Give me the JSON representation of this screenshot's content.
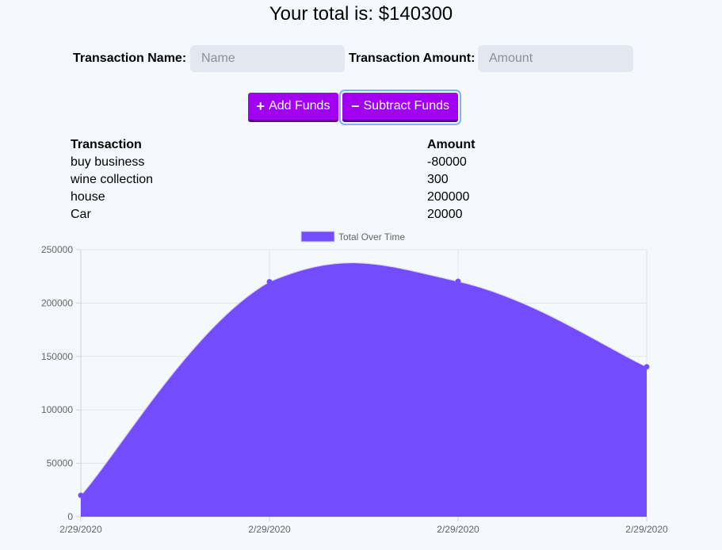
{
  "header": {
    "total_text": "Your total is: $140300"
  },
  "form": {
    "name_label": "Transaction Name:",
    "name_placeholder": "Name",
    "amount_label": "Transaction Amount:",
    "amount_placeholder": "Amount",
    "add_label": "Add Funds",
    "subtract_label": "Subtract Funds"
  },
  "table": {
    "headers": [
      "Transaction",
      "Amount"
    ],
    "rows": [
      [
        "buy business",
        "-80000"
      ],
      [
        "wine collection",
        "300"
      ],
      [
        "house",
        "200000"
      ],
      [
        "Car",
        "20000"
      ]
    ]
  },
  "colors": {
    "accent": "#a100f2",
    "chart_fill": "#744cff",
    "focus_ring": "#7fb0ff"
  },
  "chart_data": {
    "type": "area",
    "x": [
      "2/29/2020",
      "2/29/2020",
      "2/29/2020",
      "2/29/2020"
    ],
    "series": [
      {
        "name": "Total Over Time",
        "values": [
          20000,
          220000,
          220300,
          140300
        ]
      }
    ],
    "ylim": [
      0,
      250000
    ],
    "yticks": [
      0,
      50000,
      100000,
      150000,
      200000,
      250000
    ],
    "legend": "top-center",
    "grid": true
  }
}
